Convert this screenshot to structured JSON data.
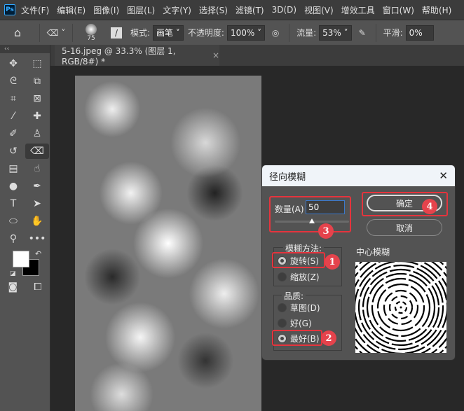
{
  "app": {
    "logo": "Ps"
  },
  "menu": [
    "文件(F)",
    "编辑(E)",
    "图像(I)",
    "图层(L)",
    "文字(Y)",
    "选择(S)",
    "滤镜(T)",
    "3D(D)",
    "视图(V)",
    "增效工具",
    "窗口(W)",
    "帮助(H)"
  ],
  "options": {
    "brush_size": "75",
    "mode_label": "模式:",
    "mode_value": "画笔",
    "opacity_label": "不透明度:",
    "opacity_value": "100%",
    "flow_label": "流量:",
    "flow_value": "53%",
    "smooth_label": "平滑:",
    "smooth_value": "0%"
  },
  "toolbar": {
    "collapse": "‹‹"
  },
  "document_tab": {
    "title": "5-16.jpeg @ 33.3% (图层 1, RGB/8#) *",
    "close": "×"
  },
  "dialog": {
    "title": "径向模糊",
    "close": "✕",
    "amount_label": "数量(A)",
    "amount_value": "50",
    "amount_fraction": 0.5,
    "ok": "确定",
    "cancel": "取消",
    "method_label": "模糊方法:",
    "method_options": [
      "旋转(S)",
      "缩放(Z)"
    ],
    "method_selected": 0,
    "quality_label": "品质:",
    "quality_options": [
      "草图(D)",
      "好(G)",
      "最好(B)"
    ],
    "quality_selected": 2,
    "center_label": "中心模糊"
  },
  "annotations": [
    "1",
    "2",
    "3",
    "4"
  ],
  "colors": {
    "highlight": "#e5343d"
  }
}
